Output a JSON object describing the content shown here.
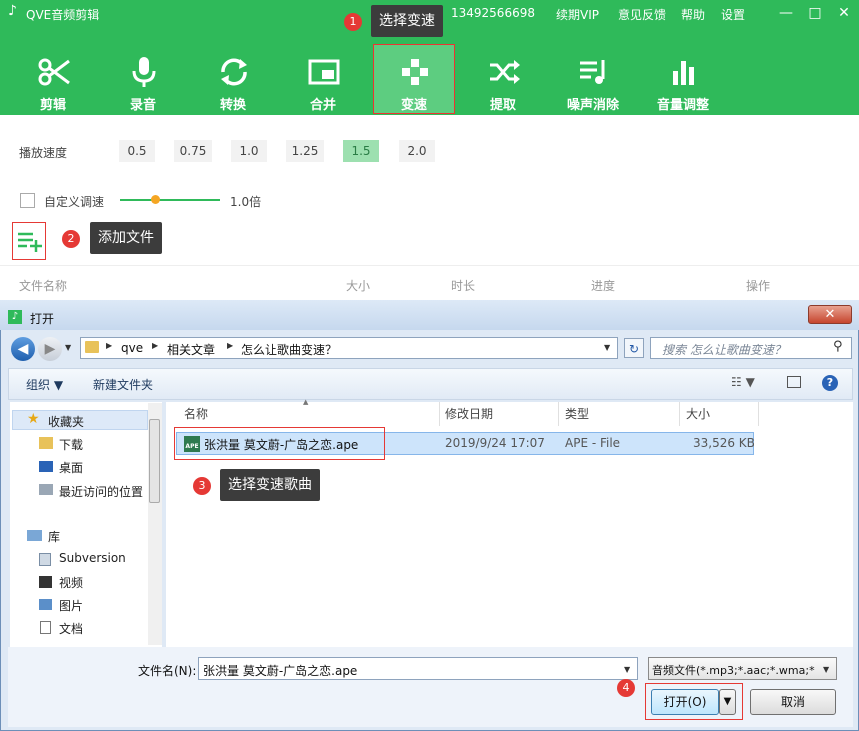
{
  "app": {
    "title": "QVE音频剪辑",
    "phone": "13492566698",
    "links": [
      "续期VIP",
      "意见反馈",
      "帮助",
      "设置"
    ],
    "window_controls": [
      "—",
      "□",
      "✕"
    ]
  },
  "tools": [
    {
      "label": "剪辑",
      "icon": "scissors-icon"
    },
    {
      "label": "录音",
      "icon": "microphone-icon"
    },
    {
      "label": "转换",
      "icon": "convert-icon"
    },
    {
      "label": "合并",
      "icon": "merge-icon"
    },
    {
      "label": "变速",
      "icon": "speed-icon",
      "active": true
    },
    {
      "label": "提取",
      "icon": "shuffle-icon"
    },
    {
      "label": "噪声消除",
      "icon": "noise-icon"
    },
    {
      "label": "音量调整",
      "icon": "volume-bars-icon"
    }
  ],
  "annotations": [
    {
      "num": "1",
      "text": "选择变速"
    },
    {
      "num": "2",
      "text": "添加文件"
    },
    {
      "num": "3",
      "text": "选择变速歌曲"
    },
    {
      "num": "4",
      "text": ""
    }
  ],
  "speed": {
    "label": "播放速度",
    "options": [
      "0.5",
      "0.75",
      "1.0",
      "1.25",
      "1.5",
      "2.0"
    ],
    "selected": "1.5",
    "custom_label": "自定义调速",
    "custom_value": "1.0倍",
    "slider_fraction": 0.35
  },
  "table": {
    "columns": [
      "文件名称",
      "大小",
      "时长",
      "进度",
      "操作"
    ]
  },
  "dialog": {
    "title": "打开",
    "path": [
      "qve",
      "相关文章",
      "怎么让歌曲变速？"
    ],
    "search_placeholder": "搜索 怎么让歌曲变速？",
    "organize": "组织 ▼",
    "new_folder": "新建文件夹",
    "nav": {
      "favorites": "收藏夹",
      "fav_items": [
        "下载",
        "桌面",
        "最近访问的位置"
      ],
      "libraries": "库",
      "lib_items": [
        "Subversion",
        "视频",
        "图片",
        "文档"
      ]
    },
    "file_headers": [
      "名称",
      "修改日期",
      "类型",
      "大小"
    ],
    "files": [
      {
        "name": "张洪量 莫文蔚-广岛之恋.ape",
        "date": "2019/9/24 17:07",
        "type": "APE - File",
        "size": "33,526 KB",
        "icon_text": "APE"
      }
    ],
    "filename_label": "文件名(N):",
    "filename_value": "张洪量 莫文蔚-广岛之恋.ape",
    "filter": "音频文件(*.mp3;*.aac;*.wma;*",
    "open_btn": "打开(O)",
    "cancel_btn": "取消"
  },
  "colors": {
    "brand_green": "#2fba5a",
    "active_tool": "#5dcd80",
    "highlight_red": "#e53935"
  }
}
